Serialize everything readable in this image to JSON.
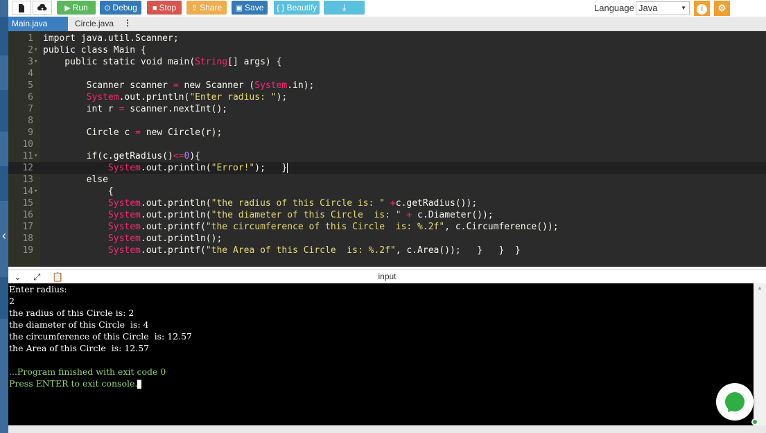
{
  "toolbar": {
    "run_label": "Run",
    "debug_label": "Debug",
    "stop_label": "Stop",
    "share_label": "Share",
    "save_label": "Save",
    "beautify_label": "{ } Beautify",
    "language_label": "Language",
    "language_value": "Java",
    "colors": {
      "run": "#5cb85c",
      "debug": "#337ab7",
      "stop": "#d9534f",
      "share": "#f0ad4e",
      "save": "#337ab7",
      "beautify": "#5bc0de",
      "download": "#5bc0de",
      "info": "#f0a030"
    }
  },
  "tabs": [
    {
      "label": "Main.java",
      "active": true
    },
    {
      "label": "Circle.java",
      "active": false
    }
  ],
  "editor": {
    "lines": [
      {
        "n": "1",
        "text": "import java.util.Scanner;"
      },
      {
        "n": "2",
        "text": "public class Main {"
      },
      {
        "n": "3",
        "text": "    public static void main(String[] args) {"
      },
      {
        "n": "4",
        "text": ""
      },
      {
        "n": "5",
        "text": "        Scanner scanner = new Scanner (System.in);"
      },
      {
        "n": "6",
        "text": "        System.out.println(\"Enter radius: \");"
      },
      {
        "n": "7",
        "text": "        int r = scanner.nextInt();"
      },
      {
        "n": "8",
        "text": ""
      },
      {
        "n": "9",
        "text": "        Circle c = new Circle(r);"
      },
      {
        "n": "10",
        "text": ""
      },
      {
        "n": "11",
        "text": "        if(c.getRadius()<=0){"
      },
      {
        "n": "12",
        "text": "            System.out.println(\"Error!\");   }"
      },
      {
        "n": "13",
        "text": "        else"
      },
      {
        "n": "14",
        "text": "            {"
      },
      {
        "n": "15",
        "text": "            System.out.println(\"the radius of this Circle is: \" +c.getRadius());"
      },
      {
        "n": "16",
        "text": "            System.out.println(\"the diameter of this Circle  is: \" + c.Diameter());"
      },
      {
        "n": "17",
        "text": "            System.out.printf(\"the circumference of this Circle  is: %.2f\", c.Circumference());"
      },
      {
        "n": "18",
        "text": "            System.out.println();"
      },
      {
        "n": "19",
        "text": "            System.out.printf(\"the Area of this Circle  is: %.2f\", c.Area());   }   }  }"
      }
    ]
  },
  "console": {
    "title": "input",
    "lines": [
      "Enter radius:",
      "2",
      "the radius of this Circle is: 2",
      "the diameter of this Circle  is: 4",
      "the circumference of this Circle  is: 12.57",
      "the Area of this Circle  is: 12.57",
      "",
      "...Program finished with exit code 0",
      "Press ENTER to exit console."
    ]
  }
}
